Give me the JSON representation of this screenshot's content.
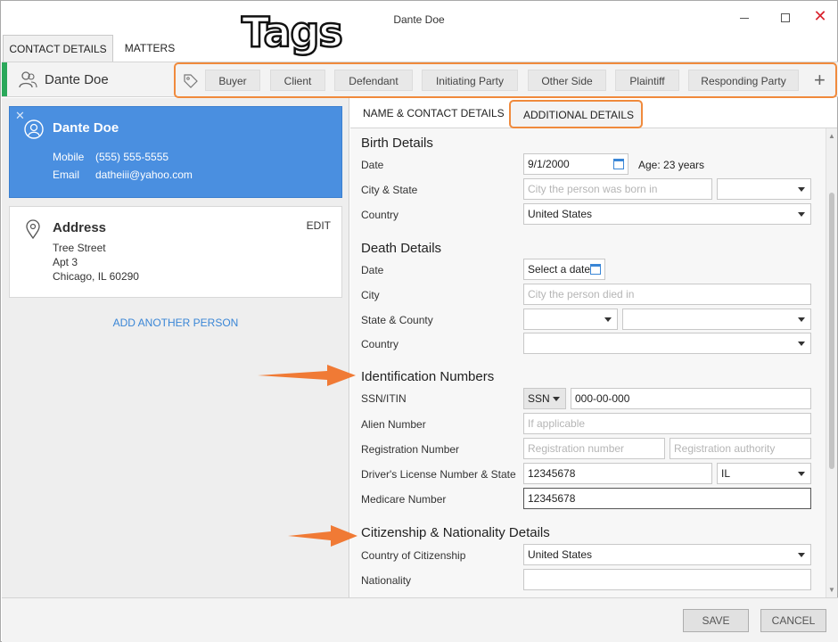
{
  "window": {
    "title": "Dante Doe"
  },
  "banner": {
    "text": "Tags"
  },
  "top_tabs": [
    {
      "label": "CONTACT DETAILS",
      "active": true
    },
    {
      "label": "MATTERS",
      "active": false
    }
  ],
  "header": {
    "name": "Dante Doe",
    "tags": [
      "Buyer",
      "Client",
      "Defendant",
      "Initiating Party",
      "Other Side",
      "Plaintiff",
      "Responding Party"
    ],
    "add_tag_symbol": "+"
  },
  "person_card": {
    "name": "Dante Doe",
    "mobile_label": "Mobile",
    "mobile_value": "(555) 555-5555",
    "email_label": "Email",
    "email_value": "datheiii@yahoo.com"
  },
  "address_card": {
    "title": "Address",
    "edit_label": "EDIT",
    "lines": [
      "Tree Street",
      "Apt 3",
      "Chicago, IL 60290"
    ]
  },
  "add_person_label": "ADD ANOTHER PERSON",
  "sub_tabs": [
    {
      "label": "NAME & CONTACT DETAILS",
      "active": false
    },
    {
      "label": "ADDITIONAL DETAILS",
      "active": true
    }
  ],
  "birth": {
    "title": "Birth Details",
    "date_label": "Date",
    "date_value": "9/1/2000",
    "age_text": "Age: 23 years",
    "city_state_label": "City & State",
    "city_placeholder": "City the person was born in",
    "country_label": "Country",
    "country_value": "United States"
  },
  "death": {
    "title": "Death Details",
    "date_label": "Date",
    "date_placeholder": "Select a date",
    "city_label": "City",
    "city_placeholder": "City the person died in",
    "state_county_label": "State & County",
    "country_label": "Country"
  },
  "identification": {
    "title": "Identification Numbers",
    "ssn_label": "SSN/ITIN",
    "ssn_type": "SSN",
    "ssn_value": "000-00-000",
    "alien_label": "Alien Number",
    "alien_placeholder": "If applicable",
    "registration_label": "Registration Number",
    "registration_placeholder": "Registration number",
    "registration_authority_placeholder": "Registration authority",
    "license_label": "Driver's License Number & State",
    "license_value": "12345678",
    "license_state": "IL",
    "medicare_label": "Medicare Number",
    "medicare_value": "12345678"
  },
  "citizenship": {
    "title": "Citizenship & Nationality Details",
    "country_label": "Country of Citizenship",
    "country_value": "United States",
    "nationality_label": "Nationality"
  },
  "footer": {
    "save_label": "SAVE",
    "cancel_label": "CANCEL"
  },
  "colors": {
    "accent_orange": "#f08a3c",
    "card_blue": "#4a8fe0",
    "link_blue": "#3a86d6",
    "status_green": "#2aa85a",
    "close_red": "#d9232e"
  }
}
